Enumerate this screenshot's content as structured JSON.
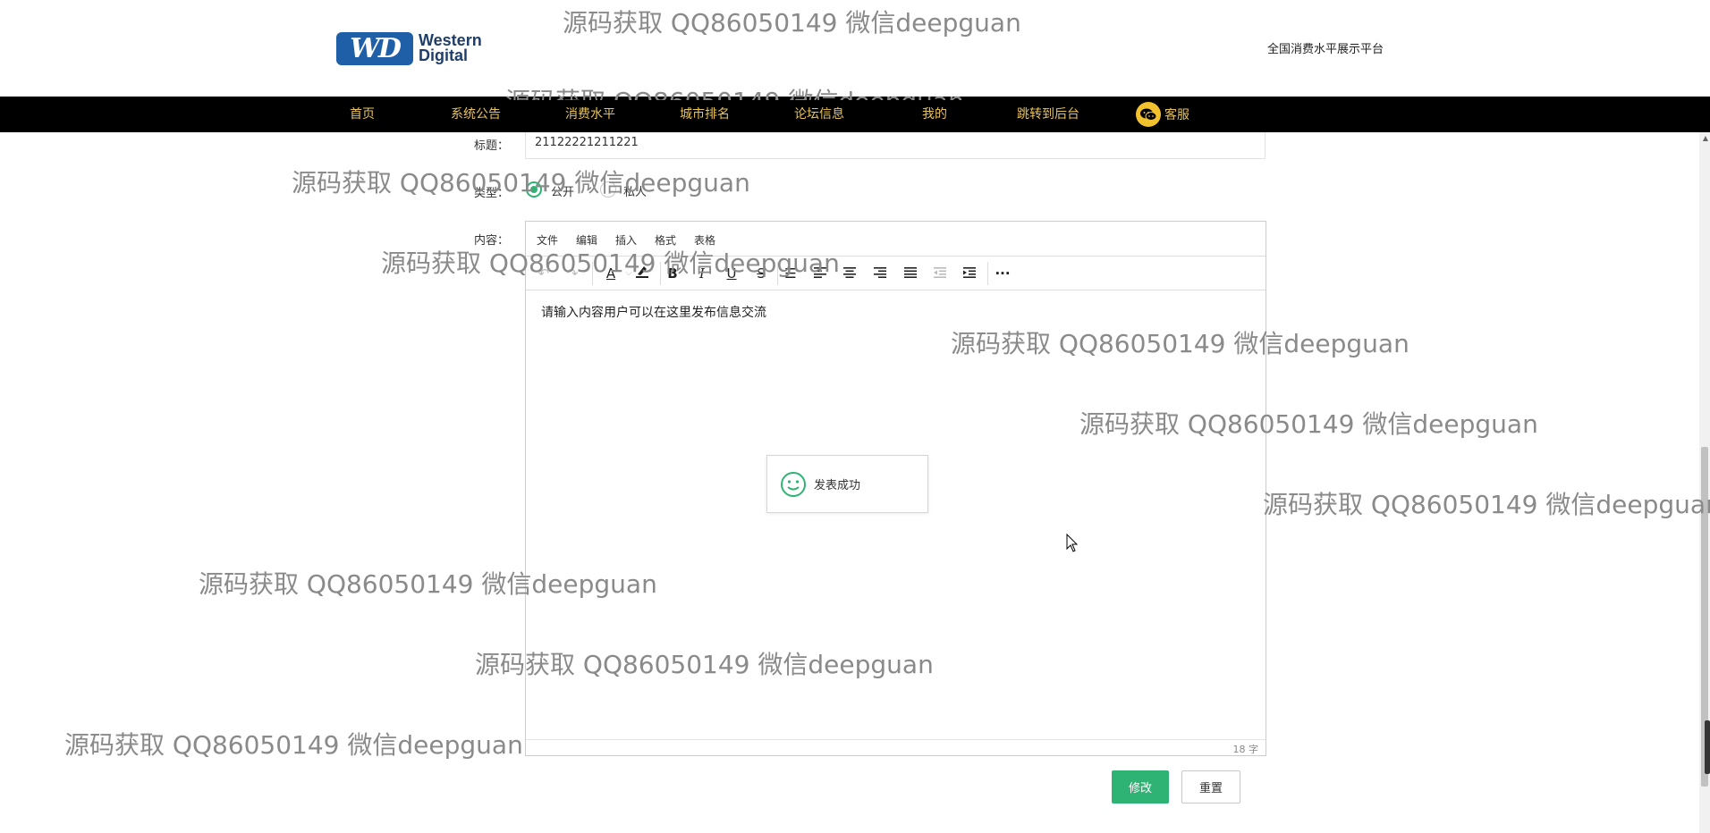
{
  "header": {
    "logo_line1": "Western",
    "logo_line2": "Digital",
    "logo_mark": "WD",
    "slogan": "全国消费水平展示平台"
  },
  "nav": {
    "items": [
      "首页",
      "系统公告",
      "消费水平",
      "城市排名",
      "论坛信息",
      "我的",
      "跳转到后台"
    ],
    "service": "客服"
  },
  "form": {
    "title_label": "标题：",
    "title_value": "21122221211221",
    "type_label": "类型：",
    "type_options": [
      "公开",
      "私人"
    ],
    "type_selected": "公开",
    "content_label": "内容："
  },
  "editor": {
    "menus": [
      "文件",
      "编辑",
      "插入",
      "格式",
      "表格"
    ],
    "content": "请输入内容用户可以在这里发布信息交流",
    "word_count": "18 字"
  },
  "toast": {
    "message": "发表成功"
  },
  "buttons": {
    "submit": "修改",
    "reset": "重置"
  },
  "watermark": "源码获取 QQ86050149 微信deepguan",
  "colors": {
    "accent": "#2fb375",
    "nav_bg": "#000000",
    "nav_text": "#e8c35a"
  }
}
